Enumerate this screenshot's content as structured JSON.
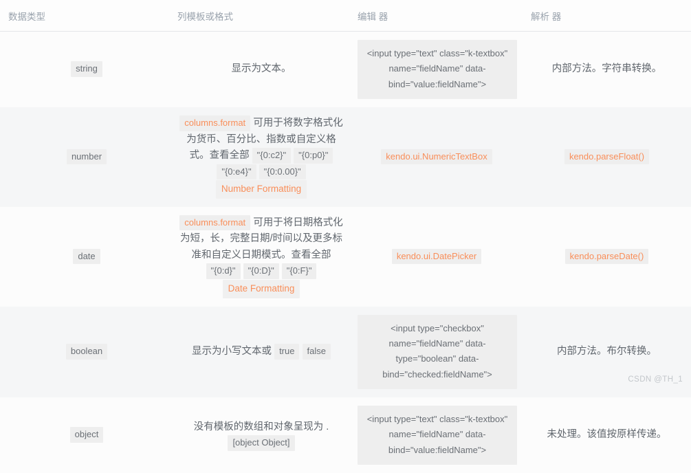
{
  "table": {
    "headers": [
      {
        "label": "数据类型"
      },
      {
        "label": "列模板或格式"
      },
      {
        "label": "编辑 器"
      },
      {
        "label": "解析 器"
      }
    ],
    "rows": [
      {
        "type": "string",
        "template": {
          "lead": "显示为文本。",
          "codes": [],
          "link": "",
          "tail": ""
        },
        "editor_block": "<input type=\"text\" class=\"k-textbox\" name=\"fieldName\" data-bind=\"value:fieldName\">",
        "editor_code": "",
        "parser_text": "内部方法。字符串转换。",
        "parser_code": ""
      },
      {
        "type": "number",
        "template": {
          "head_code": "columns.format",
          "lead": " 可用于将数字格式化为货币、百分比、指数或自定义格式。查看全部 ",
          "codes": [
            "\"{0:c2}\"",
            "\"{0:p0}\"",
            "\"{0:e4}\"",
            "\"{0:0.00}\""
          ],
          "link": "Number Formatting"
        },
        "editor_block": "",
        "editor_code": "kendo.ui.NumericTextBox",
        "parser_text": "",
        "parser_code": "kendo.parseFloat()"
      },
      {
        "type": "date",
        "template": {
          "head_code": "columns.format",
          "lead": " 可用于将日期格式化为短，长，完整日期/时间以及更多标准和自定义日期模式。查看全部 ",
          "codes": [
            "\"{0:d}\"",
            "\"{0:D}\"",
            "\"{0:F}\""
          ],
          "link": "Date Formatting"
        },
        "editor_block": "",
        "editor_code": "kendo.ui.DatePicker",
        "parser_text": "",
        "parser_code": "kendo.parseDate()"
      },
      {
        "type": "boolean",
        "template": {
          "lead": "显示为小写文本或 ",
          "codes": [
            "true",
            "false"
          ],
          "link": ""
        },
        "editor_block": "<input type=\"checkbox\" name=\"fieldName\" data-type=\"boolean\" data-bind=\"checked:fieldName\">",
        "editor_code": "",
        "parser_text": "内部方法。布尔转换。",
        "parser_code": ""
      },
      {
        "type": "object",
        "template": {
          "lead": "没有模板的数组和对象呈现为 .",
          "codes": [
            "[object Object]"
          ],
          "link": ""
        },
        "editor_block": "<input type=\"text\" class=\"k-textbox\" name=\"fieldName\" data-bind=\"value:fieldName\">",
        "editor_code": "",
        "parser_text": "未处理。该值按原样传递。",
        "parser_code": ""
      }
    ]
  },
  "editor_block_lines": {
    "textbox": [
      "<input type=\"text\" class=\"k-textbox\"",
      "name=\"fieldName\" data-",
      "bind=\"value:fieldName\">"
    ],
    "checkbox": [
      "<input type=\"checkbox\"",
      "name=\"fieldName\" data-",
      "type=\"boolean\" data-",
      "bind=\"checked:fieldName\">"
    ]
  },
  "watermark": "CSDN @TH_1",
  "colors": {
    "accent": "#f98e59",
    "text": "#60666d",
    "header_text": "#9aa3ad",
    "code_bg": "#eeeeee",
    "row_even_bg": "#f5f6f7",
    "row_odd_bg": "#fcfcfc"
  }
}
